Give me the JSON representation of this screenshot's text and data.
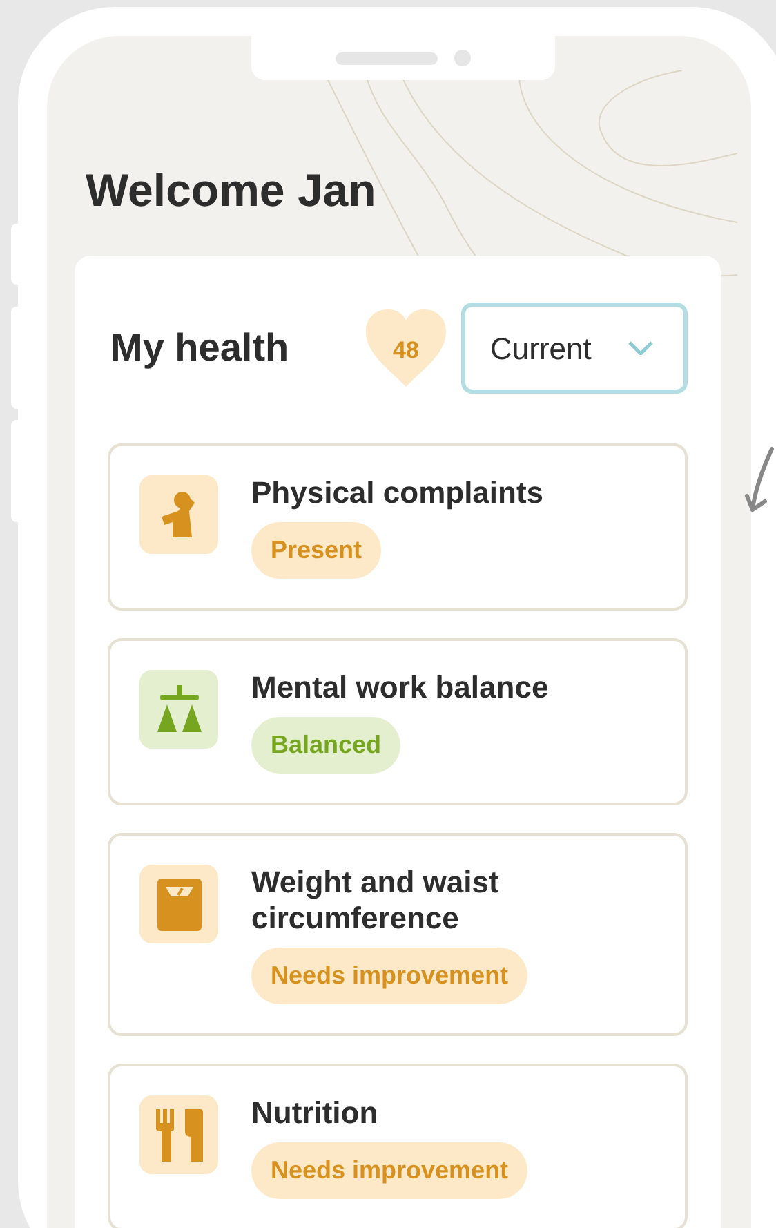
{
  "greeting": "Welcome Jan",
  "health": {
    "title": "My health",
    "score": "48",
    "period": {
      "value": "Current"
    }
  },
  "items": [
    {
      "kind": "complaint",
      "title": "Physical complaints",
      "status": {
        "label": "Present",
        "kind": "warning"
      }
    },
    {
      "kind": "balance",
      "title": "Mental work balance",
      "status": {
        "label": "Balanced",
        "kind": "good"
      }
    },
    {
      "kind": "scale",
      "title": "Weight and waist circumference",
      "status": {
        "label": "Needs improvement",
        "kind": "warning"
      }
    },
    {
      "kind": "food",
      "title": "Nutrition",
      "status": {
        "label": "Needs improvement",
        "kind": "warning"
      }
    }
  ]
}
